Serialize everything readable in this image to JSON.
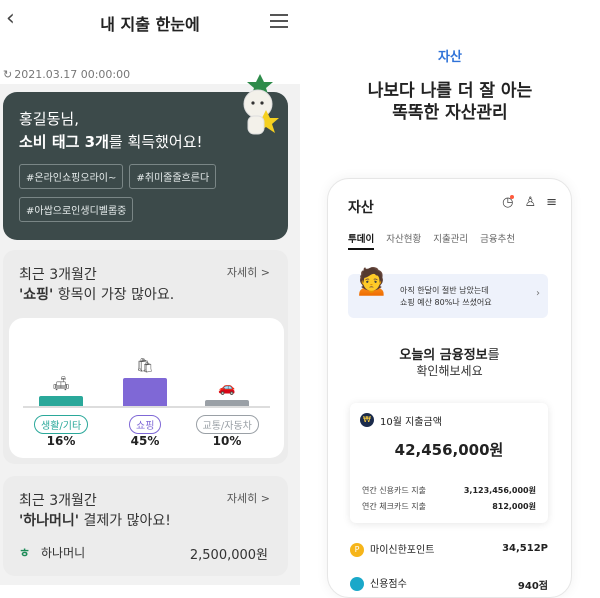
{
  "left": {
    "header": {
      "back_icon": "chevron-left-icon",
      "title": "내 지출 한눈에",
      "menu_icon": "hamburger-icon"
    },
    "timestamp": "2021.03.17 00:00:00",
    "tag_card": {
      "greeting": "홍길동님,",
      "message_bold": "소비 태그 3개",
      "message_rest": "를 획득했어요!",
      "chips": [
        "#온라인쇼핑오라이~",
        "#취미줄줄흐른다",
        "#아쌉으로인생디벨롭중"
      ],
      "bg_color": "#3c4a4a"
    },
    "category_card": {
      "title": "최근 3개월간",
      "highlight": "'쇼핑'",
      "rest": " 항목이 가장 많아요.",
      "more": "자세히 >",
      "chart_data": {
        "type": "bar",
        "categories": [
          "생활/기타",
          "쇼핑",
          "교통/자동차"
        ],
        "values": [
          16,
          45,
          10
        ],
        "value_labels": [
          "16%",
          "45%",
          "10%"
        ],
        "colors": [
          "#2aa89a",
          "#7f68d6",
          "#9aa0a6"
        ],
        "icons": [
          "sofa-icon",
          "shopping-bag-icon",
          "car-icon"
        ]
      }
    },
    "payment_card": {
      "title": "최근 3개월간",
      "highlight": "'하나머니'",
      "rest": " 결제가 많아요!",
      "more": "자세히 >",
      "item_name": "하나머니",
      "item_amount": "2,500,000원"
    }
  },
  "right": {
    "subtitle": "자산",
    "headline1": "나보다 나를 더 잘 아는",
    "headline2": "똑똑한 자산관리",
    "phone": {
      "title": "자산",
      "icons": [
        "alarm-icon",
        "person-icon",
        "hamburger-icon"
      ],
      "tabs": [
        "투데이",
        "자산현황",
        "지출관리",
        "금융추천"
      ],
      "active_tab": "투데이",
      "banner_line1": "아직 한달이 절반 남았는데",
      "banner_line2": "쇼핑 예산 80%나 쓰셨어요",
      "info_bold": "오늘의 금융정보",
      "info_rest": "를",
      "info_line2": "확인해보세요",
      "spend_label": "10월 지출금액",
      "spend_amount": "42,456,000원",
      "credit_label": "연간 신용카드 지출",
      "credit_value": "3,123,456,000원",
      "check_label": "연간 체크카드 지출",
      "check_value": "812,000원",
      "point_label": "마이신한포인트",
      "point_value": "34,512P",
      "score_label": "신용점수",
      "score_value": "940점"
    }
  }
}
